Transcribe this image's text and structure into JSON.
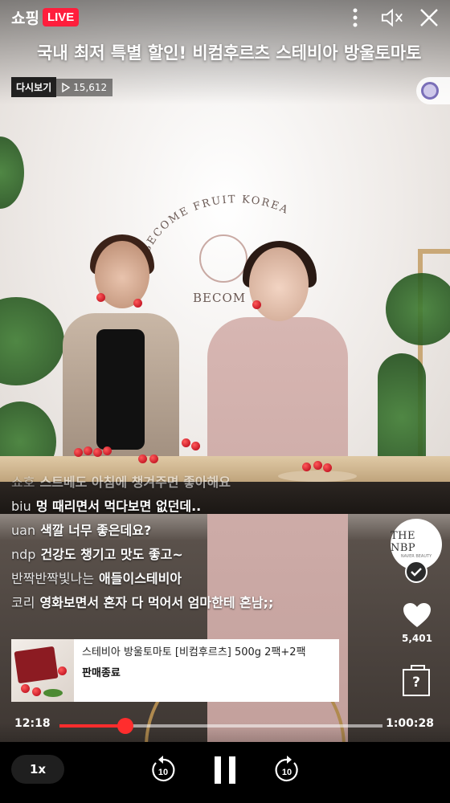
{
  "header": {
    "brand": "쇼핑",
    "live_badge": "LIVE",
    "title": "국내 최저 특별 할인! 비컴후르츠 스테비아 방울토마토",
    "replay_label": "다시보기",
    "view_count": "15,612"
  },
  "top_icons": [
    "more-vert-icon",
    "mute-icon",
    "close-icon"
  ],
  "set_sign": {
    "arch_text": "BECOME FRUIT KOREA",
    "sub_text": "BECOM"
  },
  "chat": [
    {
      "user": "쇼호",
      "message": "스트베도 아침에 챙겨주면 좋아해요",
      "faded": true
    },
    {
      "user": "biu",
      "message": "멍 때리면서 먹다보면 없던데..",
      "faded": false
    },
    {
      "user": "uan",
      "message": "색깔 너무 좋은데요?",
      "faded": false
    },
    {
      "user": "ndp",
      "message": "건강도 챙기고 맛도 좋고~",
      "faded": false
    },
    {
      "user": "반짝반짝빛나는",
      "message": "애들이스테비아",
      "faded": false
    },
    {
      "user": "코리",
      "message": "영화보면서 혼자 다 먹어서 엄마한테 혼남;;",
      "faded": false
    }
  ],
  "seller": {
    "name": "THE NBP",
    "sub": "NAVER BEAUTY"
  },
  "likes": {
    "count": "5,401"
  },
  "help": {
    "label": "?"
  },
  "product": {
    "name": "스테비아 방울토마토 [비컴후르츠] 500g 2팩+2팩",
    "status": "판매종료"
  },
  "playback": {
    "current_time": "12:18",
    "total_time": "1:00:28",
    "progress": 0.203,
    "speed": "1x",
    "rewind_seconds": "10",
    "forward_seconds": "10"
  },
  "colors": {
    "live_red": "#ff1e3c",
    "progress_red": "#ff2d2d"
  }
}
